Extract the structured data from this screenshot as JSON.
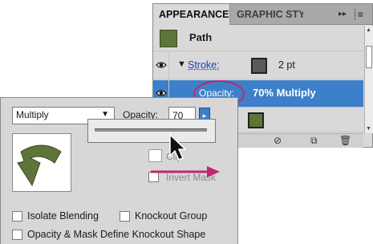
{
  "appearance_panel": {
    "tabs": [
      "APPEARANCE",
      "GRAPHIC STY"
    ],
    "menu_button": "▸▸",
    "menu_icon": "≡",
    "path_label": "Path",
    "stroke_label": "Stroke:",
    "stroke_value": "2 pt",
    "opacity_label": "Opacity:",
    "opacity_value": "70% Multiply",
    "colors": {
      "highlight": "#3d7fc9",
      "swatch_green": "#5f7438",
      "callout": "#c0266c"
    }
  },
  "transparency_panel": {
    "blend_mode": "Multiply",
    "opacity_label": "Opacity:",
    "opacity_value": "70",
    "clip_label": "Clip",
    "invert_mask_label": "Invert Mask",
    "isolate_blending_label": "Isolate Blending",
    "knockout_group_label": "Knockout Group",
    "opacity_mask_label": "Opacity & Mask Define Knockout Shape"
  },
  "icons": [
    "eye-icon",
    "mouse-pointer-icon",
    "delete-icon",
    "new-item-icon",
    "clear-icon"
  ]
}
